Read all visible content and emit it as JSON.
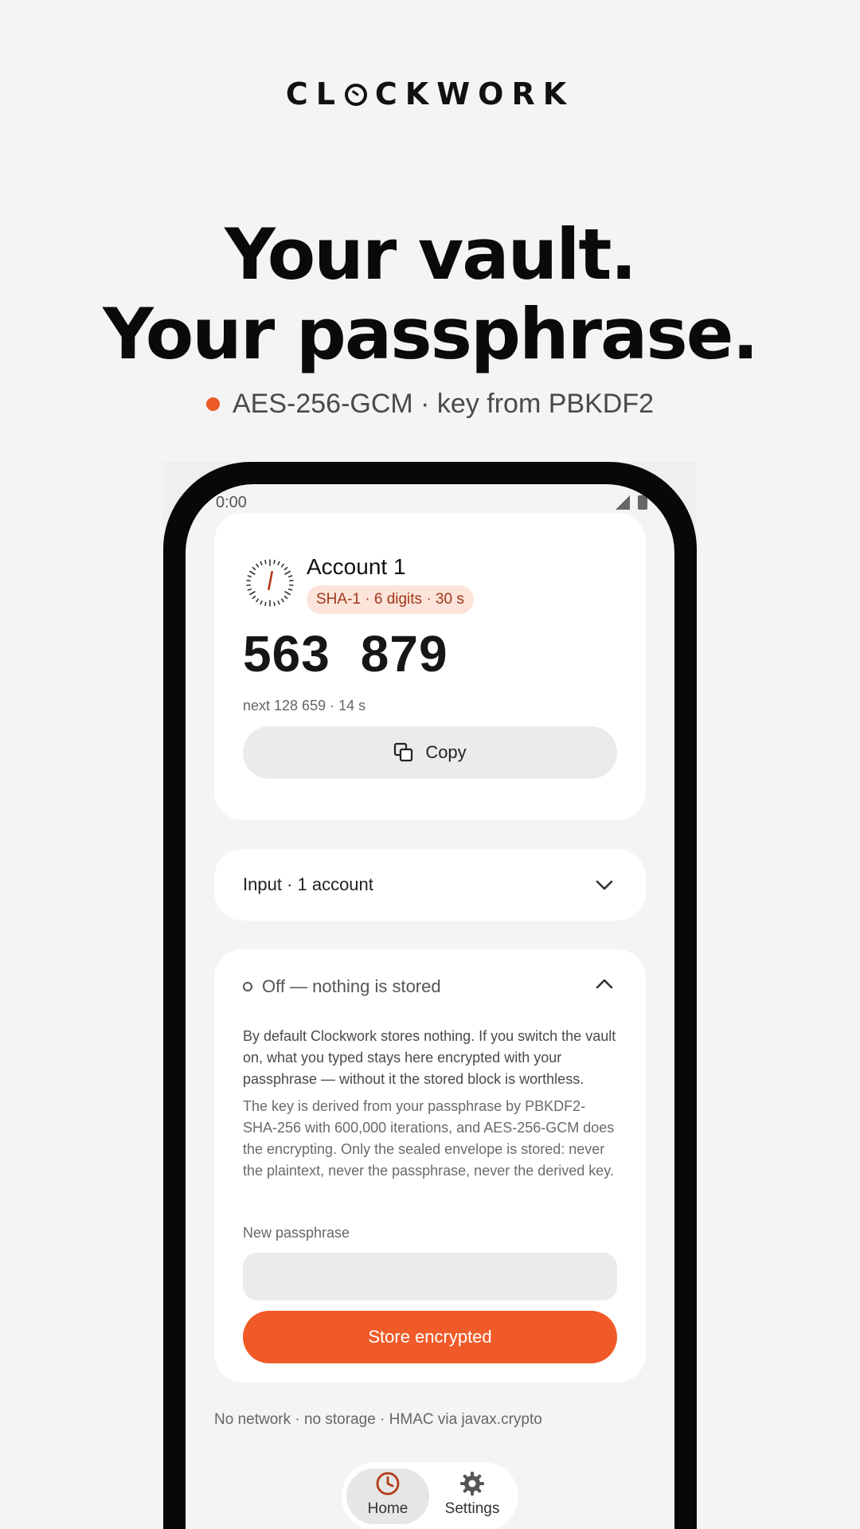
{
  "brand": {
    "pre": "CL",
    "post": "CKWORK",
    "icon": "clock-icon"
  },
  "hero": {
    "line1": "Your vault.",
    "line2": "Your passphrase.",
    "tagline": "AES-256-GCM · key from PBKDF2",
    "accent": "#ec5a2a"
  },
  "status_bar": {
    "time": "0:00",
    "icons": [
      "signal-icon",
      "battery-icon"
    ]
  },
  "account_card": {
    "name": "Account 1",
    "badge": "SHA-1 · 6 digits · 30 s",
    "code_part1": "563",
    "code_part2": "879",
    "next": "next 128 659 · 14 s",
    "copy_label": "Copy",
    "countdown_fraction": 0.47,
    "icons": [
      "countdown-gauge-icon",
      "copy-icon"
    ]
  },
  "input_row": {
    "label": "Input · 1 account",
    "icon": "chevron-down-icon"
  },
  "vault_card": {
    "status": "Off — nothing is stored",
    "paragraph1": "By default Clockwork stores nothing. If you switch the vault on, what you typed stays here encrypted with your passphrase — without it the stored block is worthless.",
    "paragraph2": "The key is derived from your passphrase by PBKDF2-SHA-256 with 600,000 iterations, and AES-256-GCM does the encrypting. Only the sealed envelope is stored: never the plaintext, never the passphrase, never the derived key.",
    "field_label": "New passphrase",
    "field_value": "",
    "store_label": "Store encrypted",
    "icon": "chevron-up-icon",
    "button_color": "#f05a28"
  },
  "footer_note": "No network · no storage · HMAC via javax.crypto",
  "nav": {
    "home_label": "Home",
    "settings_label": "Settings",
    "selected": "Home",
    "icons": [
      "home-clock-icon",
      "settings-gear-icon"
    ]
  }
}
